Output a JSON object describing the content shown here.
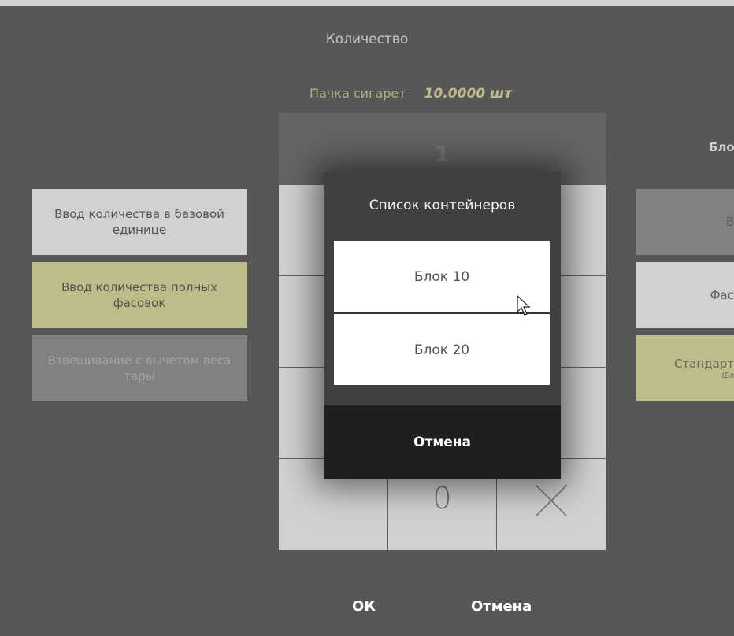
{
  "header": {
    "title": "Количество"
  },
  "product": {
    "name": "Пачка сигарет",
    "quantity": "10.0000 шт"
  },
  "display": {
    "value": "1"
  },
  "keypad": {
    "zero": "0",
    "clear_symbol": "×"
  },
  "left_modes": [
    {
      "label": "Ввод количества в базовой единице",
      "state": "normal"
    },
    {
      "label": "Ввод количества полных фасовок",
      "state": "selected"
    },
    {
      "label": "Взвешивание с вычетом веса тары",
      "state": "disabled"
    }
  ],
  "right_panel": {
    "label": "Бло",
    "items": [
      {
        "label": "В",
        "sub": ""
      },
      {
        "label": "Фас",
        "sub": ""
      },
      {
        "label": "Стандарт",
        "sub": "(Бл"
      }
    ]
  },
  "dialog": {
    "title": "Список контейнеров",
    "items": [
      "Блок 10",
      "Блок 20"
    ],
    "cancel_label": "Отмена"
  },
  "footer": {
    "ok_label": "ОК",
    "cancel_label": "Отмена"
  },
  "colors": {
    "background": "#6b6b6b",
    "accent_yellow": "#e8e7a9",
    "dialog_bg": "#404040"
  }
}
